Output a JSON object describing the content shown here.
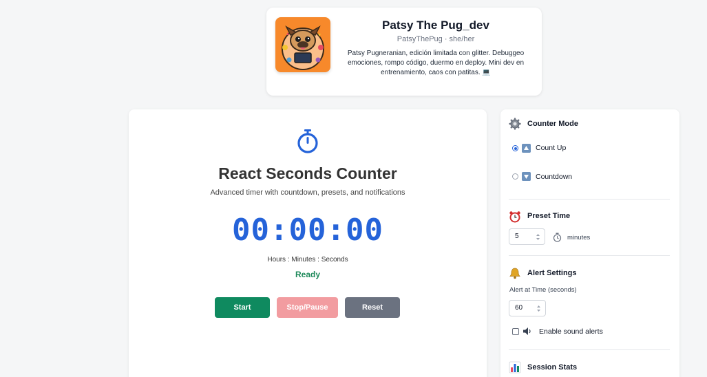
{
  "profile": {
    "name": "Patsy The Pug_dev",
    "handle": "PatsyThePug · she/her",
    "bio": "Patsy Pugneranian, edición limitada con glitter. Debuggeo emociones, rompo código, duermo en deploy. Mini dev en entrenamiento, caos con patitas. 💻"
  },
  "timer": {
    "title": "React Seconds Counter",
    "subtitle": "Advanced timer with countdown, presets, and notifications",
    "display": "00:00:00",
    "units": "Hours : Minutes : Seconds",
    "status": "Ready",
    "status_color": "#1f8a5b",
    "accent_color": "#2563d9"
  },
  "controls": {
    "start_label": "Start",
    "stop_label": "Stop/Pause",
    "reset_label": "Reset"
  },
  "settings": {
    "counter_mode": {
      "title": "Counter Mode",
      "icon": "gear-icon",
      "options": [
        {
          "label": "Count Up",
          "icon": "up-arrow-icon",
          "selected": true
        },
        {
          "label": "Countdown",
          "icon": "down-arrow-icon",
          "selected": false
        }
      ]
    },
    "preset_time": {
      "title": "Preset Time",
      "icon": "alarm-clock-icon",
      "value": "5",
      "unit": "minutes"
    },
    "alert_settings": {
      "title": "Alert Settings",
      "icon": "bell-icon",
      "alert_label": "Alert at Time (seconds)",
      "alert_value": "60",
      "sound_label": "Enable sound alerts",
      "sound_enabled": false
    },
    "session_stats": {
      "title": "Session Stats",
      "icon": "bar-chart-icon"
    }
  }
}
